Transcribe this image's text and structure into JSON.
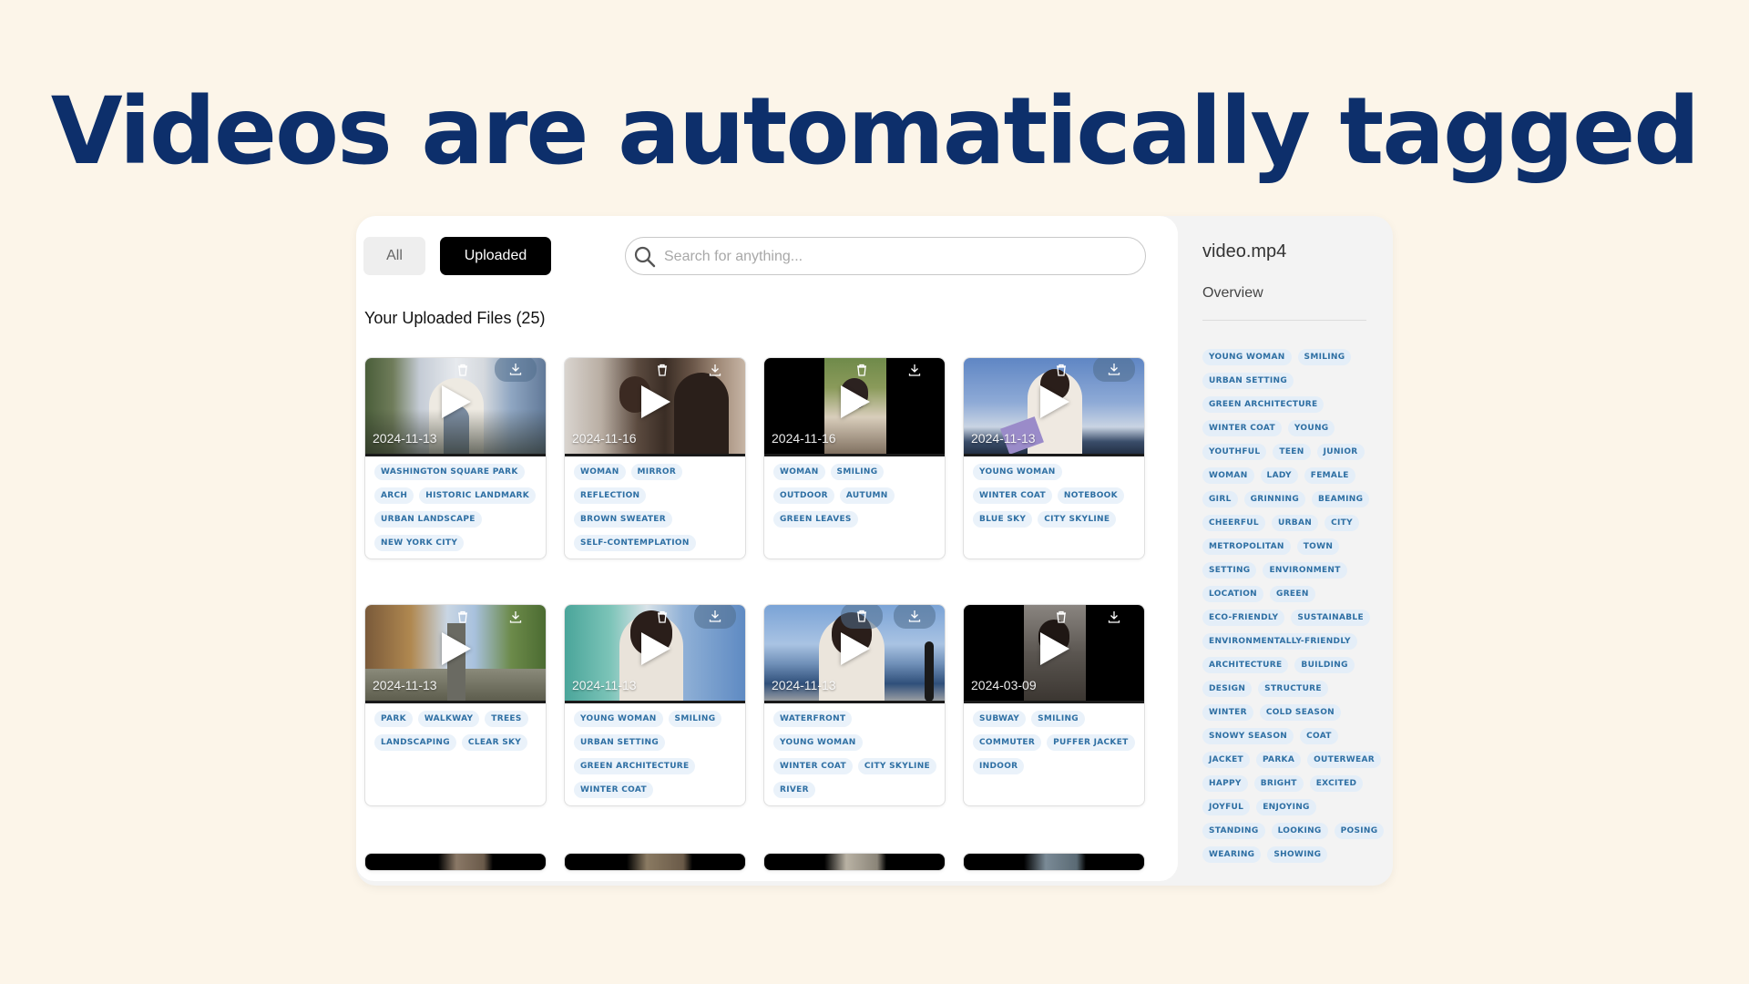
{
  "headline": "Videos are automatically tagged",
  "filters": {
    "all": "All",
    "uploaded": "Uploaded"
  },
  "search": {
    "placeholder": "Search for anything..."
  },
  "files_heading": "Your Uploaded Files (25)",
  "cards": [
    {
      "date": "2024-11-13",
      "tags": [
        "Washington Square Park",
        "Arch",
        "Historic Landmark",
        "Urban Landscape",
        "New York City"
      ]
    },
    {
      "date": "2024-11-16",
      "tags": [
        "Woman",
        "Mirror",
        "Reflection",
        "Brown Sweater",
        "Self-Contemplation"
      ]
    },
    {
      "date": "2024-11-16",
      "tags": [
        "Woman",
        "Smiling",
        "Outdoor",
        "Autumn",
        "Green Leaves"
      ]
    },
    {
      "date": "2024-11-13",
      "tags": [
        "Young Woman",
        "Winter Coat",
        "Notebook",
        "Blue Sky",
        "City Skyline"
      ]
    },
    {
      "date": "2024-11-13",
      "tags": [
        "Park",
        "Walkway",
        "Trees",
        "Landscaping",
        "Clear Sky"
      ]
    },
    {
      "date": "2024-11-13",
      "tags": [
        "Young Woman",
        "Smiling",
        "Urban Setting",
        "Green Architecture",
        "Winter Coat"
      ]
    },
    {
      "date": "2024-11-13",
      "tags": [
        "Waterfront",
        "Young Woman",
        "Winter Coat",
        "City Skyline",
        "River"
      ]
    },
    {
      "date": "2024-03-09",
      "tags": [
        "Subway",
        "Smiling",
        "Commuter",
        "Puffer Jacket",
        "Indoor"
      ]
    }
  ],
  "sidebar": {
    "filename": "video.mp4",
    "tab": "Overview",
    "tags": [
      "Young Woman",
      "Smiling",
      "Urban Setting",
      "Green Architecture",
      "Winter Coat",
      "Young",
      "Youthful",
      "Teen",
      "Junior",
      "Woman",
      "Lady",
      "Female",
      "Girl",
      "Grinning",
      "Beaming",
      "Cheerful",
      "Urban",
      "City",
      "Metropolitan",
      "Town",
      "Setting",
      "Environment",
      "Location",
      "Green",
      "Eco-friendly",
      "Sustainable",
      "Environmentally-friendly",
      "Architecture",
      "Building",
      "Design",
      "Structure",
      "Winter",
      "Cold Season",
      "Snowy Season",
      "Coat",
      "Jacket",
      "Parka",
      "Outerwear",
      "Happy",
      "Bright",
      "Excited",
      "Joyful",
      "Enjoying",
      "Standing",
      "Looking",
      "Posing",
      "Wearing",
      "Showing"
    ]
  },
  "icons": {
    "search": "search-icon",
    "delete": "trash-icon",
    "download": "download-icon",
    "play": "play-icon"
  },
  "colors": {
    "background": "#fcf5e9",
    "headline": "#0d2f6b",
    "tag_text": "#2e6fa3",
    "tag_bg": "#eaf2fa"
  }
}
